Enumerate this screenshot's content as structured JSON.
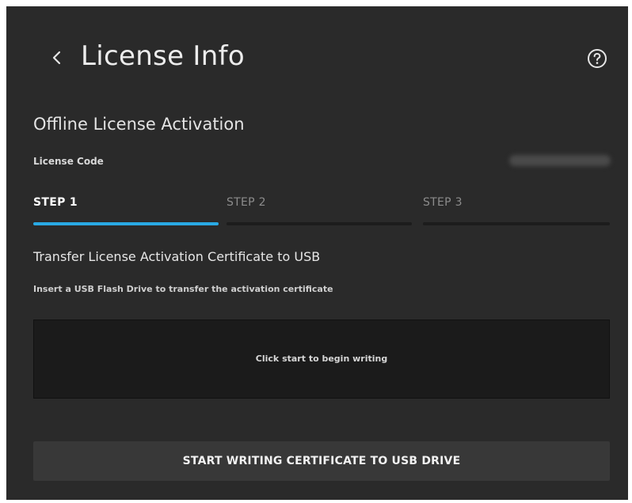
{
  "header": {
    "title": "License Info",
    "back_icon": "chevron-left-icon",
    "help_icon": "help-circle-icon"
  },
  "section": {
    "title": "Offline License Activation",
    "license_code_label": "License Code"
  },
  "steps": [
    {
      "label": "STEP 1",
      "active": true
    },
    {
      "label": "STEP 2",
      "active": false
    },
    {
      "label": "STEP 3",
      "active": false
    }
  ],
  "step_content": {
    "description": "Transfer License Activation Certificate to USB",
    "hint": "Insert a USB Flash Drive to transfer the activation certificate",
    "status": "Click start to begin writing"
  },
  "actions": {
    "start_button_label": "START WRITING CERTIFICATE TO USB DRIVE"
  },
  "colors": {
    "background": "#2a2a2a",
    "accent": "#29a9e4",
    "panel": "#1b1b1b",
    "button": "#383838"
  }
}
